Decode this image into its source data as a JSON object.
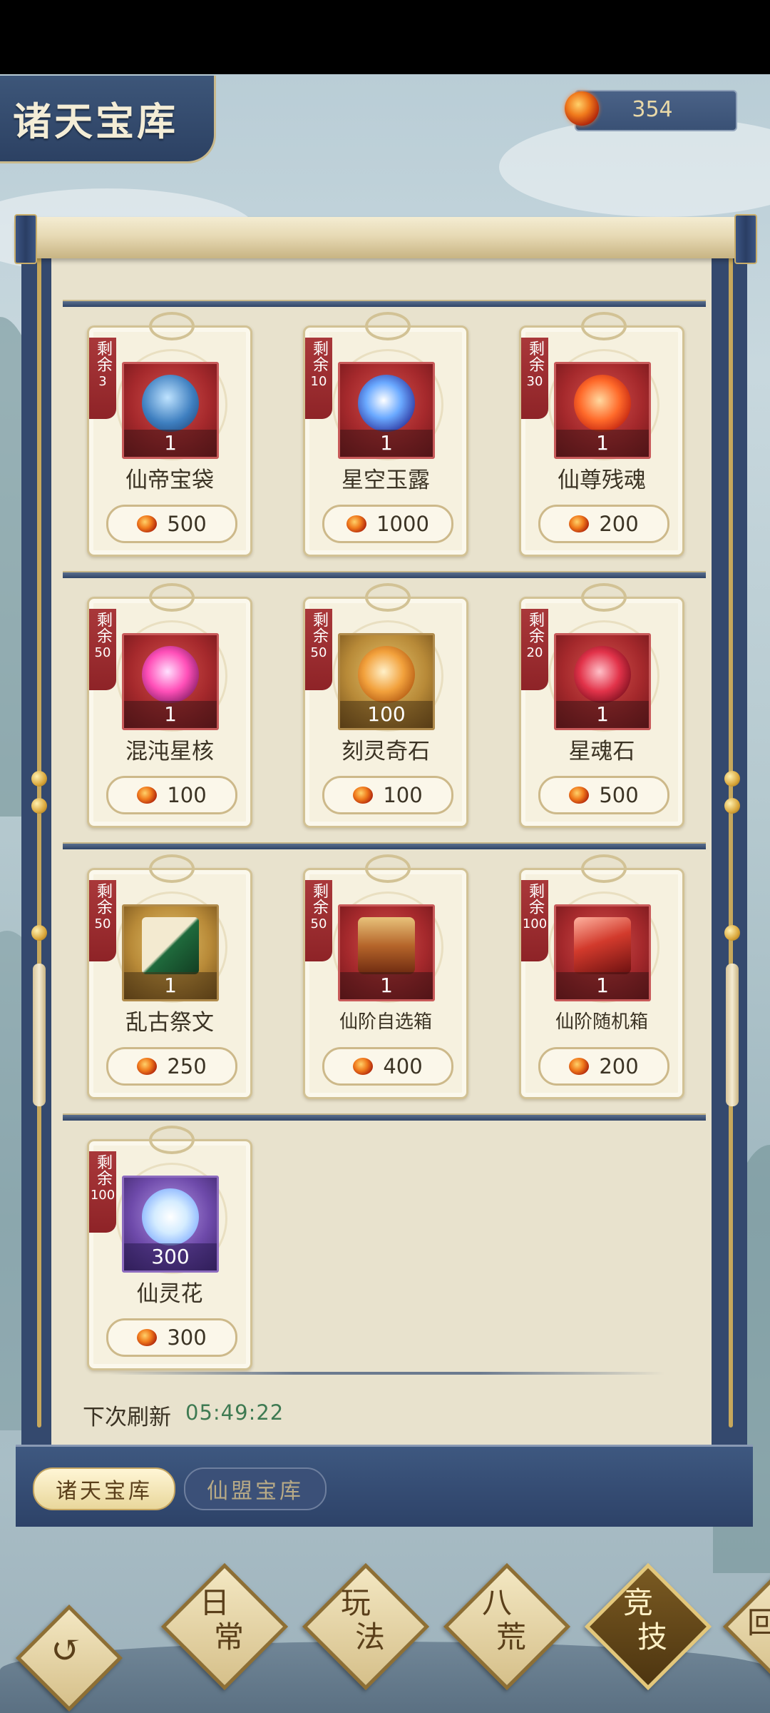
{
  "header": {
    "title": "诸天宝库",
    "currency_value": "354",
    "currency_icon": "fire-orb-icon"
  },
  "items": [
    {
      "stock_label": "剩余",
      "stock": "3",
      "qty": "1",
      "name": "仙帝宝袋",
      "price": "500",
      "icon": "treasure-bag-icon"
    },
    {
      "stock_label": "剩余",
      "stock": "10",
      "qty": "1",
      "name": "星空玉露",
      "price": "1000",
      "icon": "potion-bottle-icon"
    },
    {
      "stock_label": "剩余",
      "stock": "30",
      "qty": "1",
      "name": "仙尊残魂",
      "price": "200",
      "icon": "flame-soul-icon"
    },
    {
      "stock_label": "剩余",
      "stock": "50",
      "qty": "1",
      "name": "混沌星核",
      "price": "100",
      "icon": "star-core-icon"
    },
    {
      "stock_label": "剩余",
      "stock": "50",
      "qty": "100",
      "name": "刻灵奇石",
      "price": "100",
      "icon": "spirit-stone-icon"
    },
    {
      "stock_label": "剩余",
      "stock": "20",
      "qty": "1",
      "name": "星魂石",
      "price": "500",
      "icon": "soul-stone-icon"
    },
    {
      "stock_label": "剩余",
      "stock": "50",
      "qty": "1",
      "name": "乱古祭文",
      "price": "250",
      "icon": "scripture-book-icon"
    },
    {
      "stock_label": "剩余",
      "stock": "50",
      "qty": "1",
      "name": "仙阶自选箱",
      "price": "400",
      "icon": "treasure-chest-icon"
    },
    {
      "stock_label": "剩余",
      "stock": "100",
      "qty": "1",
      "name": "仙阶随机箱",
      "price": "200",
      "icon": "random-box-icon"
    },
    {
      "stock_label": "剩余",
      "stock": "100",
      "qty": "300",
      "name": "仙灵花",
      "price": "300",
      "icon": "lotus-flower-icon"
    }
  ],
  "refresh": {
    "label": "下次刷新",
    "time": "05:49:22"
  },
  "tabs": [
    {
      "label": "诸天宝库"
    },
    {
      "label": "仙盟宝库"
    }
  ],
  "nav": {
    "back_icon": "back-swirl-icon",
    "items": [
      {
        "line1": "日",
        "line2": "常"
      },
      {
        "line1": "玩",
        "line2": "法"
      },
      {
        "line1": "八",
        "line2": "荒"
      },
      {
        "line1": "竞",
        "line2": "技"
      },
      {
        "line1": "回",
        "line2": ""
      }
    ]
  },
  "colors": {
    "accent": "#34496e",
    "paper": "#e8e2cd",
    "stock_tag": "#a9383a",
    "timer": "#3e7a52"
  }
}
